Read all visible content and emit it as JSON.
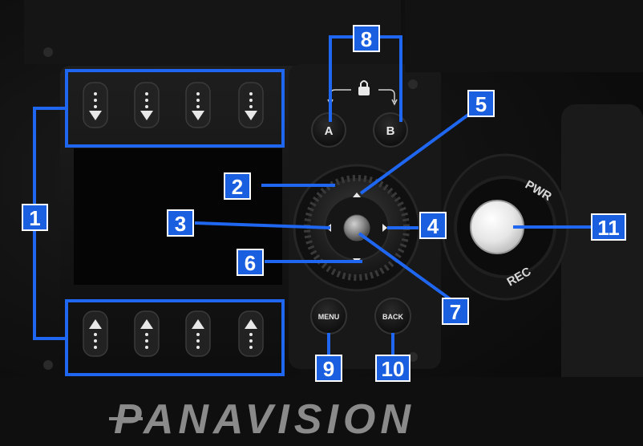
{
  "brand": {
    "name": "PANAVISION"
  },
  "buttons": {
    "a_label": "A",
    "b_label": "B",
    "menu_label": "MENU",
    "back_label": "BACK",
    "pwr_label": "PWR",
    "rec_label": "REC"
  },
  "callouts": [
    {
      "id": "1",
      "label": "1"
    },
    {
      "id": "2",
      "label": "2"
    },
    {
      "id": "3",
      "label": "3"
    },
    {
      "id": "4",
      "label": "4"
    },
    {
      "id": "5",
      "label": "5"
    },
    {
      "id": "6",
      "label": "6"
    },
    {
      "id": "7",
      "label": "7"
    },
    {
      "id": "8",
      "label": "8"
    },
    {
      "id": "9",
      "label": "9"
    },
    {
      "id": "10",
      "label": "10"
    },
    {
      "id": "11",
      "label": "11"
    }
  ],
  "colors": {
    "callout_blue": "#1a5fe0",
    "callout_line": "#1f66f0",
    "button_dark": "#1a1a1a"
  },
  "icons": {
    "lock": "lock-icon",
    "soft_down": "arrow-down-icon",
    "soft_up": "arrow-up-icon"
  }
}
